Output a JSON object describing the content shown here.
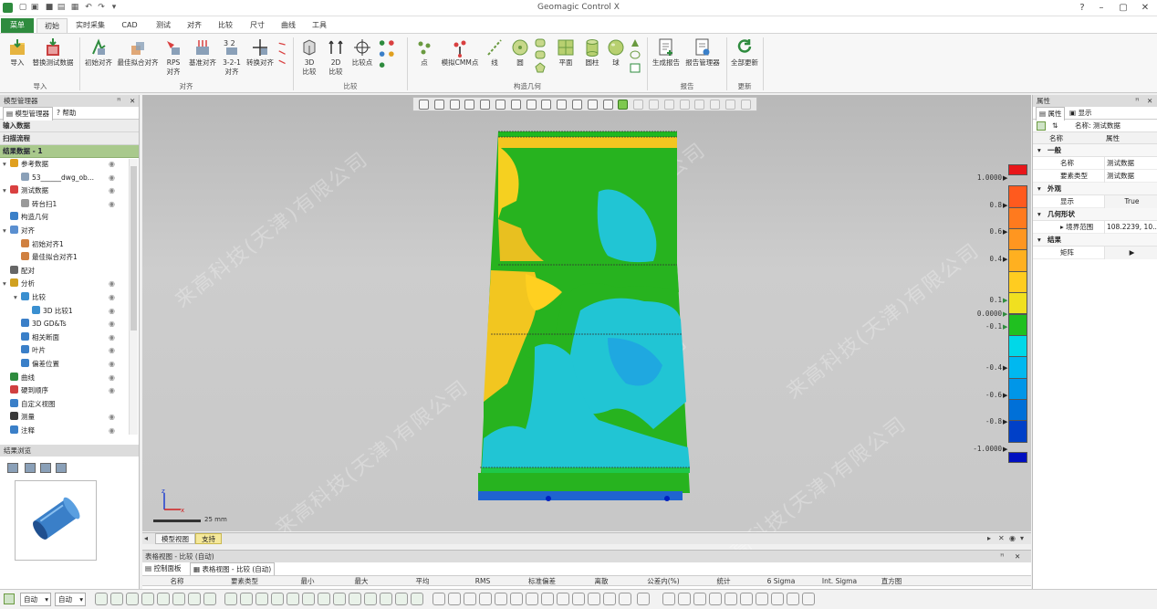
{
  "window": {
    "title": "Geomagic Control X"
  },
  "tabs": [
    "菜单",
    "初始",
    "实时采集",
    "CAD",
    "测试",
    "对齐",
    "比较",
    "尺寸",
    "曲线",
    "工具"
  ],
  "ribbon": {
    "buttons": [
      {
        "label": "导入",
        "icon": "import-folder-icon"
      },
      {
        "label": "替换测试数据",
        "icon": "replace-data-icon"
      },
      {
        "label": "初始对齐",
        "icon": "initial-align-icon"
      },
      {
        "label": "最佳拟合对齐",
        "icon": "best-fit-align-icon"
      },
      {
        "label": "RPS\n对齐",
        "icon": "rps-align-icon"
      },
      {
        "label": "基准对齐",
        "icon": "datum-align-icon"
      },
      {
        "label": "3-2-1\n对齐",
        "icon": "321-align-icon"
      },
      {
        "label": "转换对齐",
        "icon": "transform-align-icon"
      },
      {
        "label": "3D\n比较",
        "icon": "3d-compare-icon"
      },
      {
        "label": "2D\n比较",
        "icon": "2d-compare-icon"
      },
      {
        "label": "比较点",
        "icon": "compare-point-icon"
      },
      {
        "label": "点",
        "icon": "point-icon"
      },
      {
        "label": "模拟CMM点",
        "icon": "cmm-point-icon"
      },
      {
        "label": "线",
        "icon": "line-icon"
      },
      {
        "label": "圆",
        "icon": "circle-icon"
      },
      {
        "label": "平面",
        "icon": "plane-icon"
      },
      {
        "label": "圆柱",
        "icon": "cylinder-icon"
      },
      {
        "label": "球",
        "icon": "sphere-icon"
      },
      {
        "label": "生成报告",
        "icon": "report-icon"
      },
      {
        "label": "报告管理器",
        "icon": "report-manager-icon"
      },
      {
        "label": "全部更新",
        "icon": "refresh-icon"
      }
    ],
    "groups": [
      "导入",
      "对齐",
      "比较",
      "构造几何",
      "报告",
      "更新"
    ]
  },
  "left_panel": {
    "title": "模型管理器",
    "tabs": [
      "模型管理器",
      "帮助"
    ],
    "sections": [
      "输入数据",
      "扫描流程",
      "结果数据 - 1"
    ],
    "tree": [
      {
        "label": "参考数据",
        "depth": 0,
        "color": "#e0a020",
        "arrow": "▾",
        "eye": true
      },
      {
        "label": "53______dwg_ob...",
        "depth": 1,
        "color": "#8aa0b8",
        "arrow": "",
        "eye": true
      },
      {
        "label": "测试数据",
        "depth": 0,
        "color": "#d94040",
        "arrow": "▾",
        "eye": true
      },
      {
        "label": "砖台扫1",
        "depth": 1,
        "color": "#999999",
        "arrow": "",
        "eye": true
      },
      {
        "label": "构造几何",
        "depth": 0,
        "color": "#3a7fc8",
        "arrow": "",
        "eye": false
      },
      {
        "label": "对齐",
        "depth": 0,
        "color": "#5a8fd0",
        "arrow": "▾",
        "eye": false
      },
      {
        "label": "初始对齐1",
        "depth": 1,
        "color": "#d08040",
        "arrow": "",
        "eye": false
      },
      {
        "label": "最佳拟合对齐1",
        "depth": 1,
        "color": "#d08040",
        "arrow": "",
        "eye": false
      },
      {
        "label": "配对",
        "depth": 0,
        "color": "#666666",
        "arrow": "",
        "eye": false
      },
      {
        "label": "分析",
        "depth": 0,
        "color": "#d0a020",
        "arrow": "▾",
        "eye": true
      },
      {
        "label": "比较",
        "depth": 1,
        "color": "#3a8fd0",
        "arrow": "▾",
        "eye": true
      },
      {
        "label": "3D 比较1",
        "depth": 2,
        "color": "#3a8fd0",
        "arrow": "",
        "eye": true
      },
      {
        "label": "3D GD&Ts",
        "depth": 1,
        "color": "#3a7fc8",
        "arrow": "",
        "eye": true
      },
      {
        "label": "相关断面",
        "depth": 1,
        "color": "#3a7fc8",
        "arrow": "",
        "eye": true
      },
      {
        "label": "叶片",
        "depth": 1,
        "color": "#3a7fc8",
        "arrow": "",
        "eye": true
      },
      {
        "label": "偏差位置",
        "depth": 1,
        "color": "#3a7fc8",
        "arrow": "",
        "eye": true
      },
      {
        "label": "曲线",
        "depth": 0,
        "color": "#2e8b3e",
        "arrow": "",
        "eye": true
      },
      {
        "label": "硬到顺序",
        "depth": 0,
        "color": "#d04040",
        "arrow": "",
        "eye": true
      },
      {
        "label": "自定义视图",
        "depth": 0,
        "color": "#3a7fc8",
        "arrow": "",
        "eye": false
      },
      {
        "label": "测量",
        "depth": 0,
        "color": "#3a3a3a",
        "arrow": "",
        "eye": true
      },
      {
        "label": "注释",
        "depth": 0,
        "color": "#3a7fc8",
        "arrow": "",
        "eye": true
      }
    ],
    "preview_title": "结果浏览"
  },
  "viewport": {
    "watermark": "来高科技(天津)有限公司",
    "scale_label": "25 mm",
    "color_scale": {
      "labels": [
        "1.0000",
        "0.8",
        "0.6",
        "0.4",
        "0.1",
        "0.0000",
        "-0.1",
        "-0.4",
        "-0.6",
        "-0.8",
        "-1.0000"
      ],
      "values": [
        1.0,
        0.8,
        0.6,
        0.4,
        0.1,
        0.0,
        -0.1,
        -0.4,
        -0.6,
        -0.8,
        -1.0
      ],
      "colors": [
        "#e8161a",
        "#ff5a1e",
        "#ff7a1e",
        "#ff9620",
        "#ffb020",
        "#ffcc20",
        "#f0e020",
        "#20c020",
        "#00d8e8",
        "#00b8f0",
        "#0096e8",
        "#0070d8",
        "#0040c8",
        "#0010c0"
      ]
    }
  },
  "view_tabs": [
    "模型视图",
    "支持"
  ],
  "table_view": {
    "title": "表格视图 - 比较 (自动)",
    "tabs": [
      "控制面板",
      "表格视图 - 比较 (自动)"
    ],
    "columns": [
      "名称",
      "要素类型",
      "最小",
      "最大",
      "平均",
      "RMS",
      "标准偏差",
      "离散",
      "公差内(%)",
      "统计",
      "6 Sigma",
      "Int. Sigma",
      "直方图"
    ]
  },
  "right_panel": {
    "title": "属性",
    "tabs": [
      "属性",
      "显示"
    ],
    "name_label": "名称: 测试数据",
    "header": [
      "名称",
      "属性"
    ],
    "sections": [
      {
        "title": "一般",
        "rows": [
          {
            "k": "名称",
            "v": "测试数据"
          },
          {
            "k": "要素类型",
            "v": "测试数据"
          }
        ]
      },
      {
        "title": "外观",
        "rows": [
          {
            "k": "显示",
            "v": "True"
          }
        ]
      },
      {
        "title": "几何形状",
        "rows": [
          {
            "k": "▸ 境界范围",
            "v": "108.2239, 10..."
          }
        ]
      },
      {
        "title": "结果",
        "rows": [
          {
            "k": "矩阵",
            "v": "▶"
          }
        ]
      }
    ]
  },
  "bottom_bar": {
    "select1": "自动",
    "select2": "自动"
  }
}
